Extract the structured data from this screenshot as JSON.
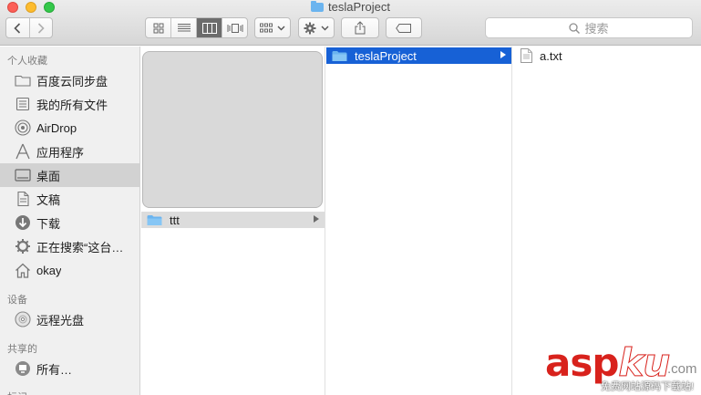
{
  "window": {
    "title": "teslaProject"
  },
  "search": {
    "placeholder": "搜索"
  },
  "sidebar": {
    "sections": {
      "favorites": "个人收藏",
      "devices": "设备",
      "shared": "共享的",
      "tags": "标记"
    },
    "favorites": [
      {
        "label": "百度云同步盘",
        "icon": "folder-icon"
      },
      {
        "label": "我的所有文件",
        "icon": "all-files-icon"
      },
      {
        "label": "AirDrop",
        "icon": "airdrop-icon"
      },
      {
        "label": "应用程序",
        "icon": "applications-icon"
      },
      {
        "label": "桌面",
        "icon": "desktop-icon",
        "selected": true
      },
      {
        "label": "文稿",
        "icon": "documents-icon"
      },
      {
        "label": "下载",
        "icon": "downloads-icon"
      },
      {
        "label": "正在搜索“这台…",
        "icon": "gear-icon"
      },
      {
        "label": "okay",
        "icon": "home-icon"
      }
    ],
    "devices": [
      {
        "label": "远程光盘",
        "icon": "disc-icon"
      }
    ],
    "shared": [
      {
        "label": "所有…",
        "icon": "network-icon"
      }
    ]
  },
  "columns": {
    "col1": {
      "folder": "ttt"
    },
    "col2": {
      "folder": "teslaProject"
    },
    "col3": {
      "file": "a.txt"
    }
  },
  "watermark": {
    "main_a": "asp",
    "main_k": "k",
    "main_u": "u",
    "com": ".com",
    "sub": "免费网站源码下载站!"
  },
  "colors": {
    "selection_blue": "#1761d6",
    "folder_blue": "#6bb4ef",
    "watermark_red": "#d8221c"
  }
}
